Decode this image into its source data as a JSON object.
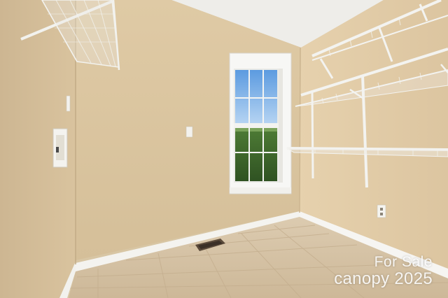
{
  "photo": {
    "subject": "empty laundry room with wire shelving, window and tile floor",
    "colors": {
      "wall_left": "#d3bd97",
      "wall_back": "#dcc7a2",
      "wall_right": "#e2cda8",
      "ceiling": "#efeeeb",
      "floor": "#d6c4a8",
      "trim": "#f5f4f0",
      "shelf": "#f3f3f0",
      "sky": "#6fa9e6",
      "trees": "#3f6e2c"
    }
  },
  "watermark": {
    "line1": "For Sale",
    "line2_brand": "canopy",
    "line2_year": "2025"
  }
}
